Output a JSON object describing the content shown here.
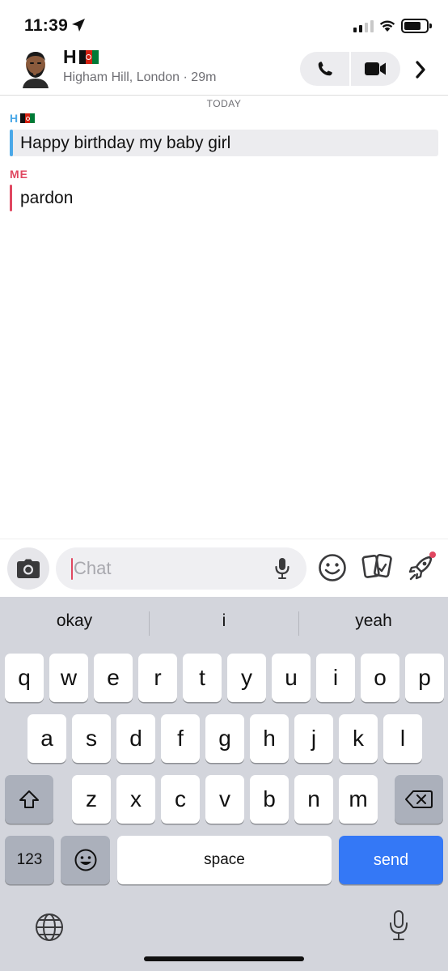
{
  "status": {
    "time": "11:39"
  },
  "header": {
    "name": "H",
    "subtitle": "Higham Hill, London · 29m"
  },
  "conversation": {
    "date_label": "TODAY",
    "messages": [
      {
        "sender": "H",
        "sender_flag": "flag-afghanistan",
        "text": "Happy birthday my baby girl",
        "accent": "#4aa8e8"
      },
      {
        "sender": "ME",
        "text": "pardon",
        "accent": "#e04760"
      }
    ]
  },
  "composer": {
    "placeholder": "Chat",
    "value": ""
  },
  "keyboard": {
    "suggestions": [
      "okay",
      "i",
      "yeah"
    ],
    "row1": [
      "q",
      "w",
      "e",
      "r",
      "t",
      "y",
      "u",
      "i",
      "o",
      "p"
    ],
    "row2": [
      "a",
      "s",
      "d",
      "f",
      "g",
      "h",
      "j",
      "k",
      "l"
    ],
    "row3": [
      "z",
      "x",
      "c",
      "v",
      "b",
      "n",
      "m"
    ],
    "numbers_label": "123",
    "space_label": "space",
    "send_label": "send"
  },
  "colors": {
    "send_key": "#3478f6",
    "keyboard_bg": "#d3d5dc",
    "me_accent": "#e04760",
    "them_accent": "#4aa8e8"
  }
}
